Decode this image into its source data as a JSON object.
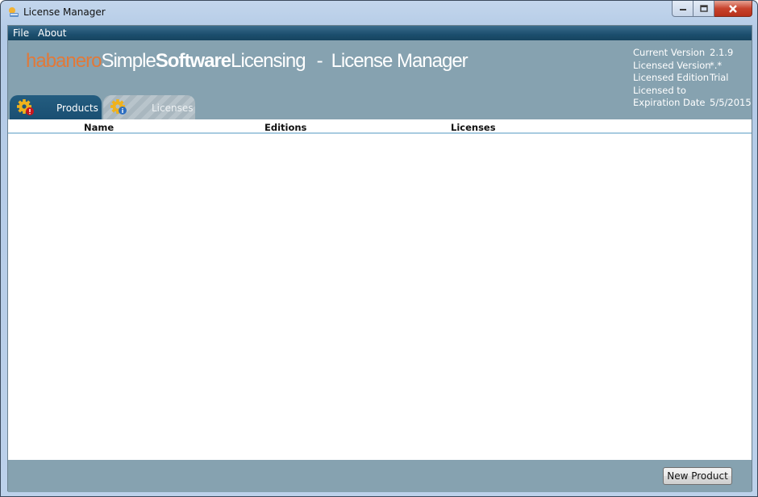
{
  "window": {
    "title": "License Manager",
    "controls": {
      "minimize": "minimize",
      "maximize": "maximize",
      "close": "close"
    }
  },
  "menu": {
    "items": [
      {
        "label": "File"
      },
      {
        "label": "About"
      }
    ]
  },
  "header": {
    "brand": {
      "part1": "habanero",
      "part2": "Simple",
      "part3": "Software",
      "part4": "Licensing",
      "separator": "-",
      "subtitle": "License Manager"
    },
    "colors": {
      "brand_orange": "#e0793a",
      "header_bg": "#86a2b0",
      "tab_active": "#1f5678"
    },
    "info": [
      {
        "label": "Current Version",
        "value": "2.1.9"
      },
      {
        "label": "Licensed Version",
        "value": "*.*"
      },
      {
        "label": "Licensed Edition",
        "value": "Trial"
      },
      {
        "label": "Licensed to",
        "value": ""
      },
      {
        "label": "Expiration Date",
        "value": "5/5/2015"
      }
    ]
  },
  "tabs": [
    {
      "label": "Products",
      "icon": "gear-alert-icon",
      "active": true
    },
    {
      "label": "Licenses",
      "icon": "gear-info-icon",
      "active": false
    }
  ],
  "grid": {
    "columns": [
      {
        "label": "Name"
      },
      {
        "label": "Editions"
      },
      {
        "label": "Licenses"
      }
    ],
    "rows": []
  },
  "footer": {
    "new_product_label": "New Product"
  }
}
